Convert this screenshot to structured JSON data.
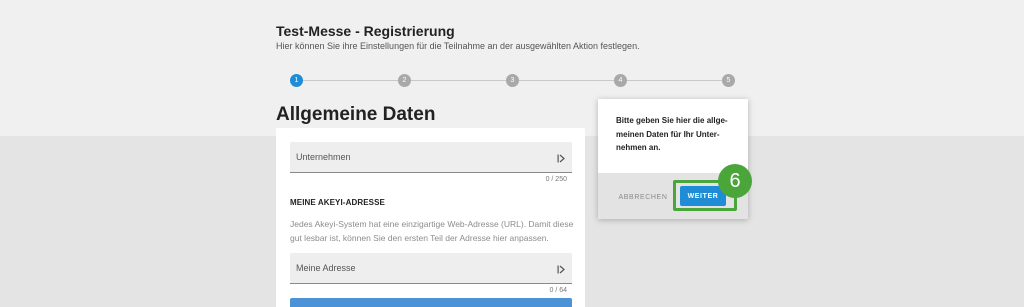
{
  "header": {
    "title": "Test-Messe - Registrierung",
    "subtitle": "Hier können Sie ihre Einstellungen für die Teilnahme an der ausgewählten Aktion festlegen."
  },
  "stepper": {
    "steps": [
      "1",
      "2",
      "3",
      "4",
      "5"
    ],
    "active_index": 0,
    "active_color": "#1f8dd6",
    "inactive_color": "#a9a9a9"
  },
  "main": {
    "section_title": "Allgemeine Daten",
    "company_field": {
      "placeholder": "Unternehmen",
      "value": "",
      "counter": "0 / 250",
      "icon": "text-field-icon"
    },
    "address_heading": "MEINE AKEYI-ADRESSE",
    "address_description": "Jedes Akeyi-System hat eine einzigartige Web-Adresse (URL). Damit diese gut lesbar ist, können Sie den ersten Teil der Adresse hier anpassen.",
    "address_field": {
      "placeholder": "Meine Adresse",
      "value": "",
      "counter": "0 / 64",
      "icon": "text-field-icon"
    }
  },
  "popover": {
    "text": "Bitte geben Sie hier die allge-meinen Daten für Ihr Unter-nehmen an.",
    "cancel_label": "ABBRECHEN",
    "next_label": "WEITER"
  },
  "annotation": {
    "badge": "6",
    "color": "#4aa53b"
  }
}
